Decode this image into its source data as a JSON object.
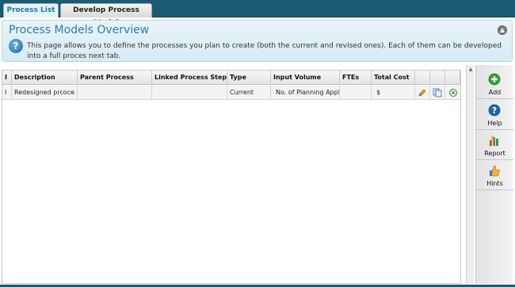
{
  "tabs": [
    {
      "label": "Process List",
      "active": true
    },
    {
      "label": "Develop Process Model",
      "active": false
    }
  ],
  "overview": {
    "title": "Process Models Overview",
    "description": "This page allows you to define the processes you plan to create (both the current and revised ones). Each of them can be developed into a full proces next tab."
  },
  "grid": {
    "columns": [
      "I",
      "Description",
      "Parent Process",
      "Linked Process Step",
      "Type",
      "Input Volume",
      "FTEs",
      "Total Cost"
    ],
    "rows": [
      {
        "indicator": "I",
        "description": "Redesigned prcoce",
        "parent": "",
        "linked": "",
        "type": "Current",
        "input_volume": "No. of Planning Appl",
        "ftes": "",
        "total_cost": "$"
      }
    ]
  },
  "toolbar": {
    "add": "Add",
    "help": "Help",
    "report": "Report",
    "hints": "Hints"
  },
  "colors": {
    "header_bar": "#1d5a73",
    "title_blue": "#1f7fb0",
    "add_green": "#2e9e2e",
    "help_blue": "#1a64a8"
  }
}
